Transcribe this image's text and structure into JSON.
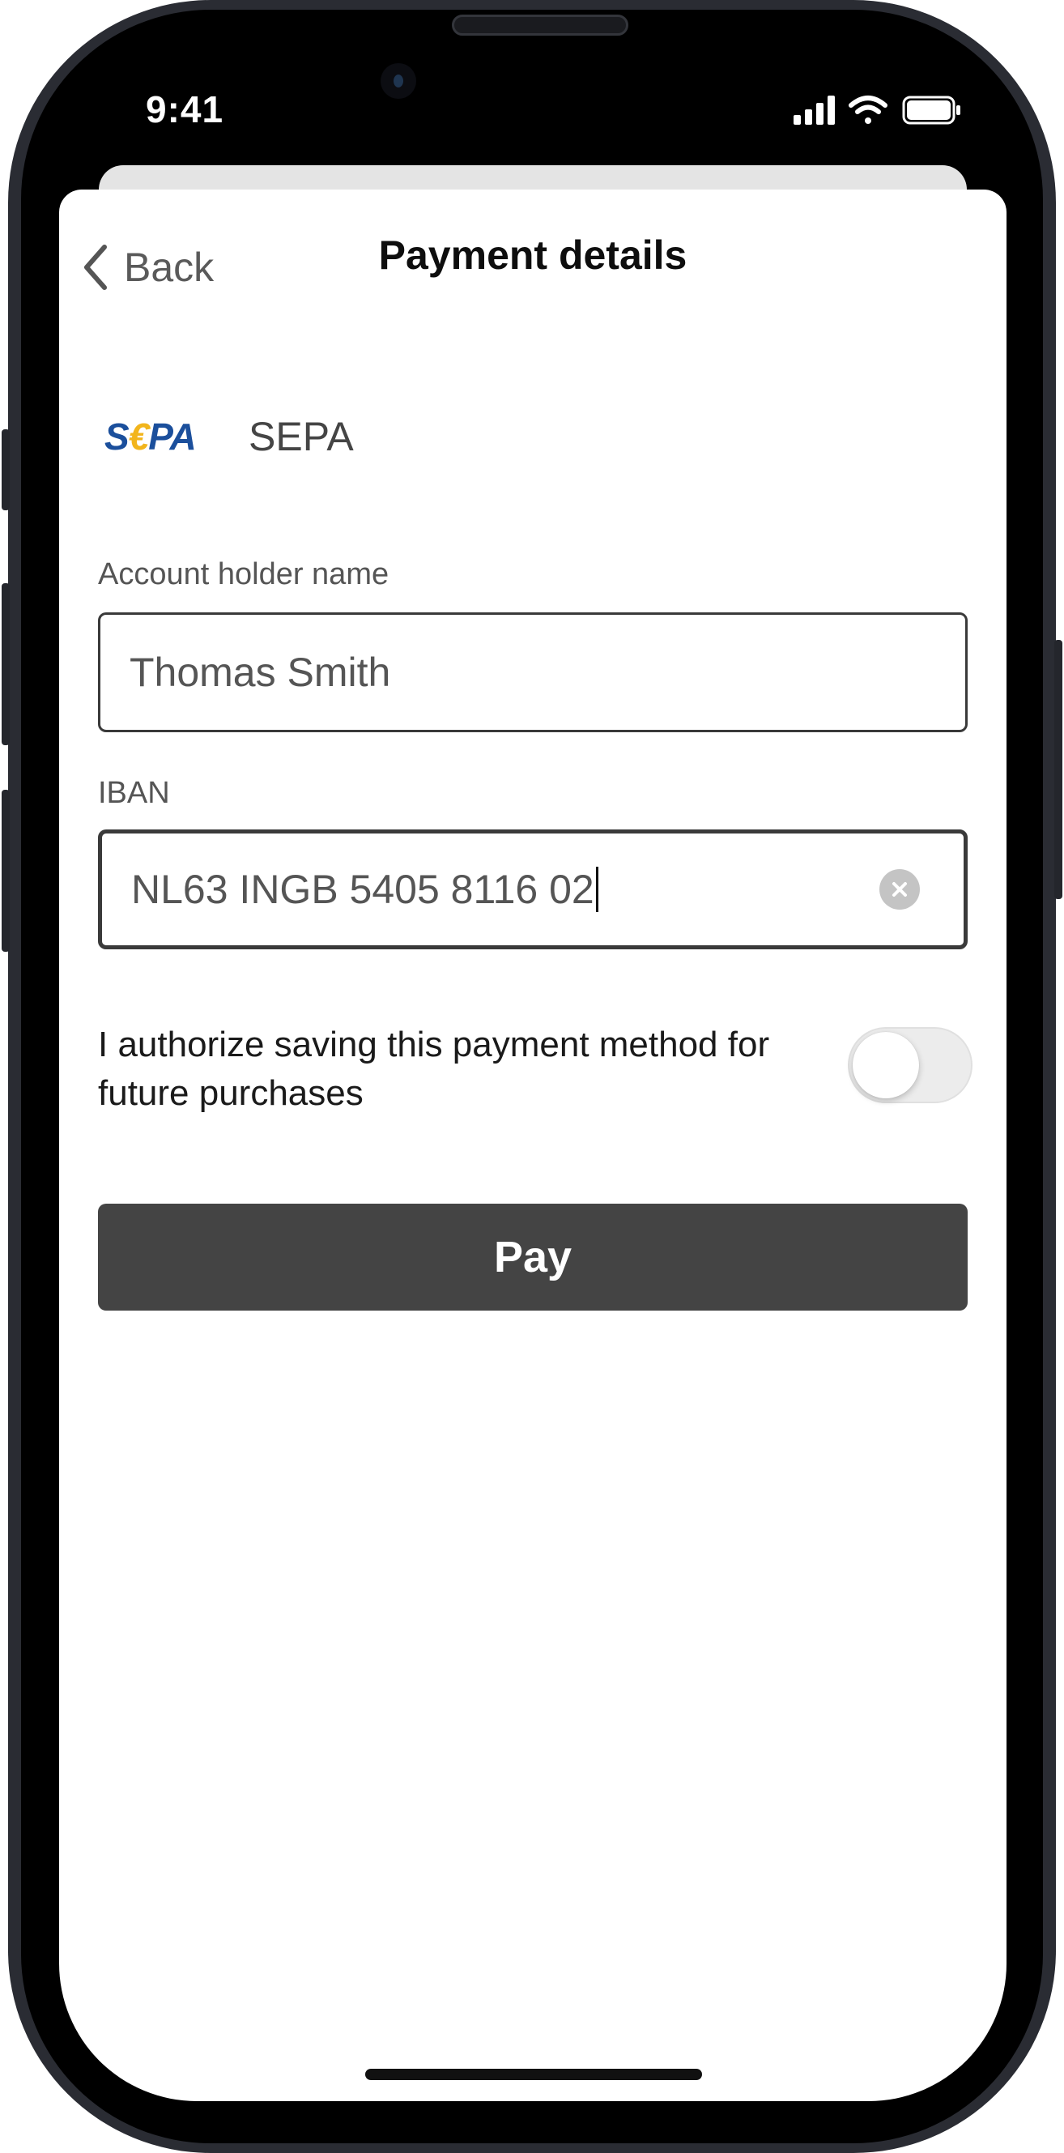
{
  "status_bar": {
    "time": "9:41",
    "icons": [
      "cellular-signal-icon",
      "wifi-icon",
      "battery-icon"
    ]
  },
  "nav": {
    "back_label": "Back",
    "title": "Payment details"
  },
  "payment_method": {
    "logo_text_s": "S",
    "logo_text_euro": "€",
    "logo_text_pa": "PA",
    "name": "SEPA"
  },
  "account_holder": {
    "label": "Account holder name",
    "value": "Thomas Smith"
  },
  "iban": {
    "label": "IBAN",
    "value": "NL63 INGB 5405 8116 02"
  },
  "consent": {
    "text": "I authorize saving this payment method for future purchases",
    "enabled": false
  },
  "pay_button": {
    "label": "Pay"
  },
  "colors": {
    "button": "#444444",
    "sepa_blue": "#1b4f9c",
    "sepa_yellow": "#f2b51c"
  }
}
